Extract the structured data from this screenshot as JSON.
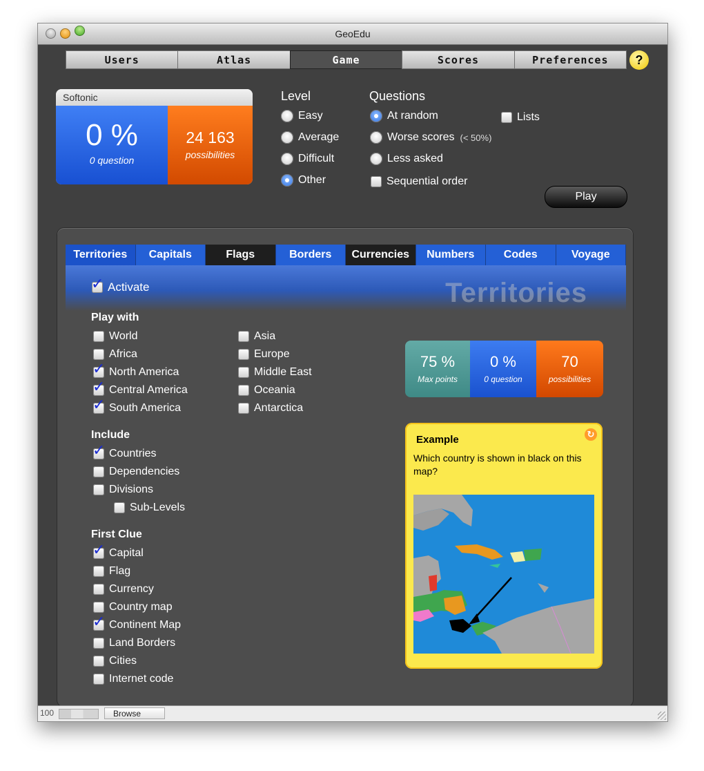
{
  "window": {
    "title": "GeoEdu"
  },
  "main_tabs": [
    "Users",
    "Atlas",
    "Game",
    "Scores",
    "Preferences"
  ],
  "help_label": "?",
  "stats": {
    "title": "Softonic",
    "percent": "0 %",
    "questions": "0 question",
    "possibilities_value": "24 163",
    "possibilities_label": "possibilities"
  },
  "level": {
    "header": "Level",
    "options": [
      "Easy",
      "Average",
      "Difficult",
      "Other"
    ],
    "selected": "Other"
  },
  "questions": {
    "header": "Questions",
    "options": [
      "At random",
      "Worse scores",
      "Less asked"
    ],
    "worse_note": "(< 50%)",
    "selected": "At random",
    "sequential_label": "Sequential order"
  },
  "lists_label": "Lists",
  "play_label": "Play",
  "sub_tabs": [
    "Territories",
    "Capitals",
    "Flags",
    "Borders",
    "Currencies",
    "Numbers",
    "Codes",
    "Voyage"
  ],
  "activate_label": "Activate",
  "banner_title": "Territories",
  "play_with": {
    "header": "Play with",
    "col1": [
      {
        "label": "World",
        "checked": false
      },
      {
        "label": "Africa",
        "checked": false
      },
      {
        "label": "North America",
        "checked": true
      },
      {
        "label": "Central America",
        "checked": true
      },
      {
        "label": "South America",
        "checked": true
      }
    ],
    "col2": [
      {
        "label": "Asia",
        "checked": false
      },
      {
        "label": "Europe",
        "checked": false
      },
      {
        "label": "Middle East",
        "checked": false
      },
      {
        "label": "Oceania",
        "checked": false
      },
      {
        "label": "Antarctica",
        "checked": false
      }
    ]
  },
  "include": {
    "header": "Include",
    "items": [
      {
        "label": "Countries",
        "checked": true
      },
      {
        "label": "Dependencies",
        "checked": false
      },
      {
        "label": "Divisions",
        "checked": false
      },
      {
        "label": "Sub-Levels",
        "checked": false
      }
    ]
  },
  "first_clue": {
    "header": "First Clue",
    "items": [
      {
        "label": "Capital",
        "checked": true
      },
      {
        "label": "Flag",
        "checked": false
      },
      {
        "label": "Currency",
        "checked": false
      },
      {
        "label": "Country map",
        "checked": false
      },
      {
        "label": "Continent Map",
        "checked": true
      },
      {
        "label": "Land Borders",
        "checked": false
      },
      {
        "label": "Cities",
        "checked": false
      },
      {
        "label": "Internet code",
        "checked": false
      }
    ]
  },
  "stats2": {
    "max_points_value": "75 %",
    "max_points_label": "Max points",
    "percent_value": "0 %",
    "question_label": "0 question",
    "possibilities_value": "70",
    "possibilities_label": "possibilities"
  },
  "example": {
    "title": "Example",
    "question": "Which country is shown in black on this map?"
  },
  "statusbar": {
    "zoom": "100",
    "mode": "Browse"
  },
  "colors": {
    "blue": "#1f5ae0",
    "orange": "#e5560a",
    "teal": "#4f9a96",
    "yellow": "#fbe94d",
    "sea": "#1f8ad8"
  }
}
